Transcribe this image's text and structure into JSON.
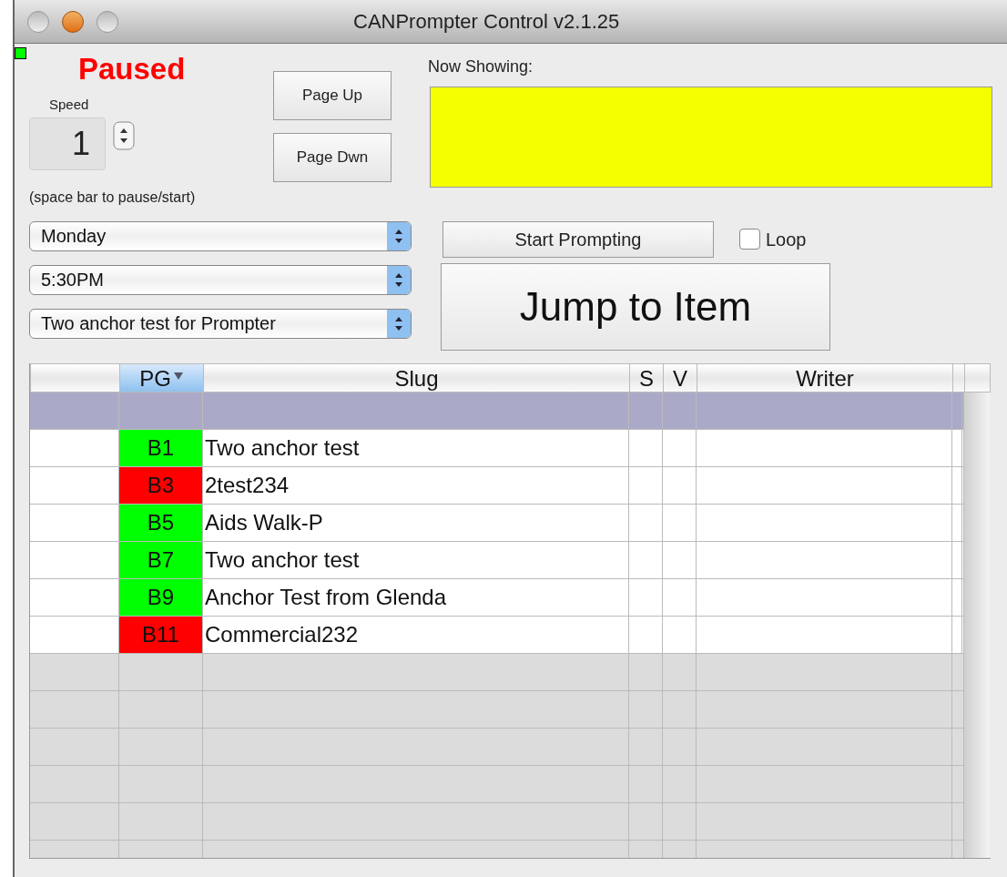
{
  "window": {
    "title": "CANPrompter Control v2.1.25"
  },
  "status": {
    "text": "Paused",
    "connected": true
  },
  "speed": {
    "label": "Speed",
    "value": "1",
    "hint": "(space bar to pause/start)"
  },
  "page_buttons": [
    "Page Up",
    "Page Dwn"
  ],
  "now_showing": {
    "label": "Now Showing:"
  },
  "selects": [
    {
      "value": "Monday"
    },
    {
      "value": "5:30PM"
    },
    {
      "value": "Two anchor test for Prompter"
    }
  ],
  "start_button": "Start Prompting",
  "loop": {
    "label": "Loop",
    "checked": false
  },
  "jump_button": "Jump to Item",
  "table": {
    "columns": [
      {
        "label": "PG",
        "sorted": true
      },
      {
        "label": "Slug",
        "sorted": false
      },
      {
        "label": "S",
        "sorted": false
      },
      {
        "label": "V",
        "sorted": false
      },
      {
        "label": "Writer",
        "sorted": false
      }
    ],
    "rows": [
      {
        "selected": true
      },
      {
        "pg": "B1",
        "slug": "Two anchor test",
        "color": "#00ff00",
        "selected": false
      },
      {
        "pg": "B3",
        "slug": "2test234",
        "color": "#ff0000",
        "selected": false
      },
      {
        "pg": "B5",
        "slug": "Aids Walk-P",
        "color": "#00ff00",
        "selected": false
      },
      {
        "pg": "B7",
        "slug": "Two anchor test",
        "color": "#00ff00",
        "selected": false
      },
      {
        "pg": "B9",
        "slug": "Anchor Test from Glenda",
        "color": "#00ff00",
        "selected": false
      },
      {
        "pg": "B11",
        "slug": "Commercial232",
        "color": "#ff0000",
        "selected": false
      }
    ]
  }
}
